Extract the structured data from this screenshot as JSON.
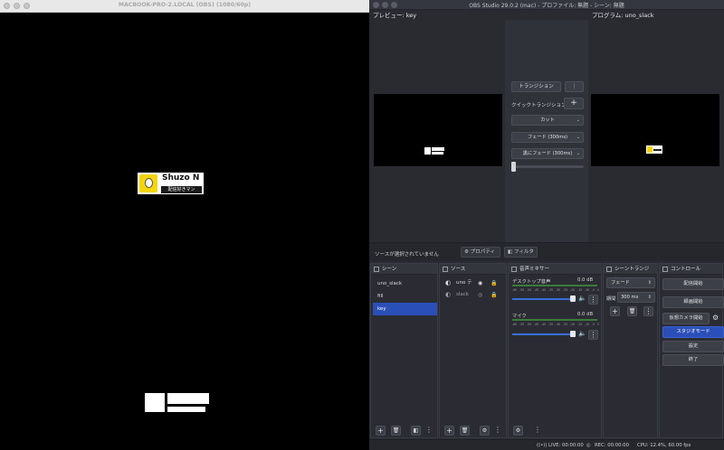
{
  "projector": {
    "title": "MACBOOK-PRO-2.LOCAL (OBS) (1080/60p)",
    "badge_name": "Shuzo N",
    "badge_tag": "配信好きマン"
  },
  "obs": {
    "title": "OBS Studio 29.0.2 (mac) - プロファイル: 無題 - シーン: 無題",
    "preview_label": "プレビュー: key",
    "program_label": "プログラム: uno_slack",
    "transition": {
      "button": "トランジション",
      "quick_label": "クイックトランジション",
      "items": [
        "カット",
        "フェード (300ms)",
        "黒にフェード (300ms)"
      ]
    },
    "source_toolbar": {
      "no_source": "ソースが選択されていません",
      "properties": "プロパティ",
      "filters": "フィルタ"
    },
    "docks": {
      "scenes": {
        "title": "シーン",
        "items": [
          "uno_slack",
          "fill",
          "key"
        ],
        "selected": "key"
      },
      "sources": {
        "title": "ソース",
        "items": [
          "uno テ",
          "slack"
        ]
      },
      "mixer": {
        "title": "音声ミキサー",
        "channels": [
          {
            "name": "デスクトップ音声",
            "level": "0.0 dB"
          },
          {
            "name": "マイク",
            "level": "0.0 dB"
          }
        ],
        "scale": [
          "-60",
          "-55",
          "-50",
          "-45",
          "-40",
          "-35",
          "-30",
          "-25",
          "-20",
          "-15",
          "-10",
          "-5",
          "0"
        ]
      },
      "scene_transitions": {
        "title": "シーントランジシ…",
        "type": "フェード",
        "duration_label": "期間",
        "duration_value": "300 ms"
      },
      "controls": {
        "title": "コントロール",
        "buttons": [
          "配信開始",
          "録画開始",
          "仮想カメラ開始",
          "スタジオモード",
          "設定",
          "終了"
        ],
        "active": "スタジオモード"
      }
    },
    "status": {
      "live": "LIVE: 00:00:00",
      "rec": "REC: 00:00:00",
      "cpu": "CPU: 12.4%, 60.00 fps"
    }
  }
}
